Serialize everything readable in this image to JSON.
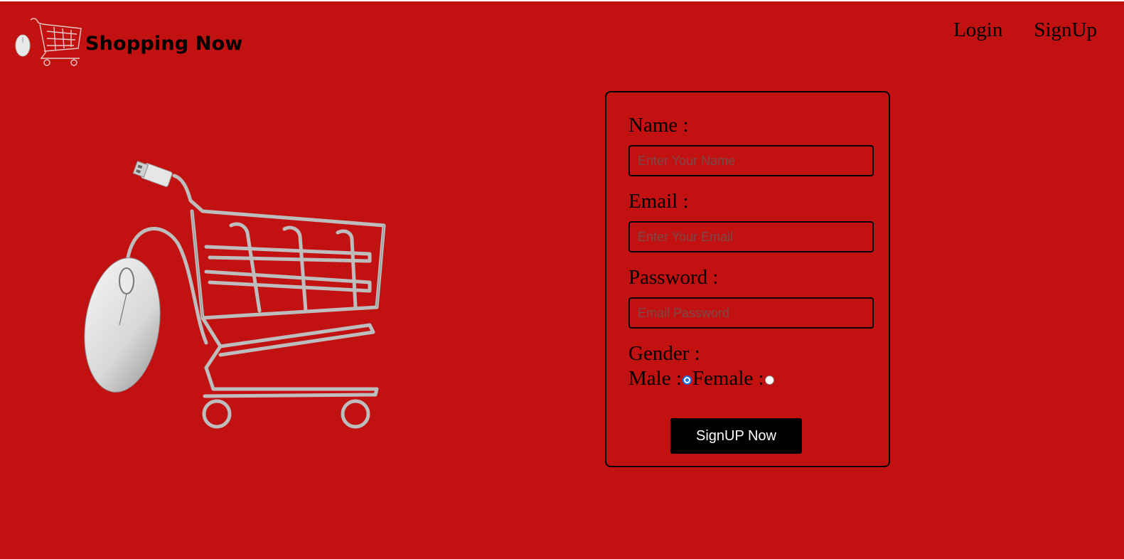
{
  "brand": {
    "name": "Shopping Now"
  },
  "nav": {
    "login": "Login",
    "signup": "SignUp"
  },
  "form": {
    "name_label": "Name :",
    "name_placeholder": "Enter Your Name",
    "email_label": "Email :",
    "email_placeholder": "Enter Your Email",
    "password_label": "Password :",
    "password_placeholder": "Email Password",
    "gender_label": "Gender :",
    "male_label": "Male :",
    "female_label": "Female :",
    "selected_gender": "Male",
    "submit_label": "SignUP Now"
  },
  "colors": {
    "background": "#c21111",
    "button": "#000000",
    "radio_accent": "#1a73e8"
  },
  "icons": {
    "logo": "cart-mouse-logo-icon",
    "hero": "cart-mouse-illustration"
  }
}
